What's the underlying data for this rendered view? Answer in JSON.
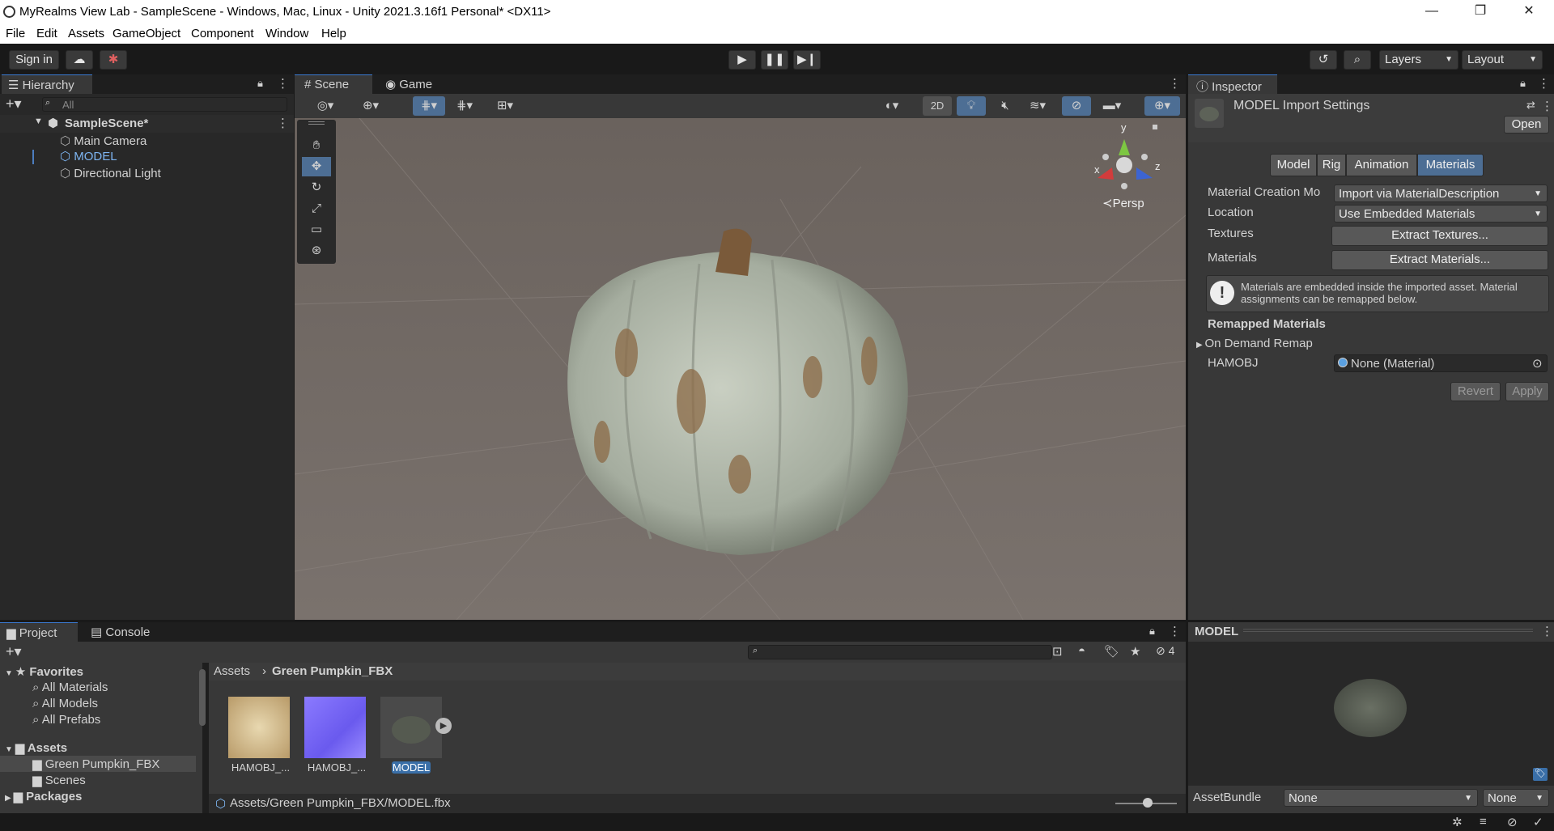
{
  "window": {
    "title": "MyRealms View Lab - SampleScene - Windows, Mac, Linux - Unity 2021.3.16f1 Personal* <DX11>",
    "minimize": "—",
    "restore": "❐",
    "close": "✕"
  },
  "menu": [
    "File",
    "Edit",
    "Assets",
    "GameObject",
    "Component",
    "Window",
    "Help"
  ],
  "toolbar": {
    "sign_in": "Sign in",
    "cloud_icon": "cloud-icon",
    "layers": "Layers",
    "layout": "Layout"
  },
  "hierarchy": {
    "tab": "Hierarchy",
    "search_placeholder": "All",
    "scene": "SampleScene*",
    "items": [
      "Main Camera",
      "MODEL",
      "Directional Light"
    ]
  },
  "scene_view": {
    "tabs": [
      "Scene",
      "Game"
    ],
    "btn_2d": "2D",
    "persp": "Persp",
    "axes": {
      "x": "x",
      "y": "y",
      "z": "z"
    }
  },
  "inspector": {
    "tab": "Inspector",
    "title": "MODEL Import Settings",
    "open": "Open",
    "tabs": [
      "Model",
      "Rig",
      "Animation",
      "Materials"
    ],
    "active_tab": "Materials",
    "material_creation_label": "Material Creation Mo",
    "material_creation_value": "Import via MaterialDescription",
    "location_label": "Location",
    "location_value": "Use Embedded Materials",
    "textures_label": "Textures",
    "extract_textures": "Extract Textures...",
    "materials_label": "Materials",
    "extract_materials": "Extract Materials...",
    "info": "Materials are embedded inside the imported asset. Material assignments can be remapped below.",
    "remapped_header": "Remapped Materials",
    "on_demand": "On Demand Remap",
    "hamobj_label": "HAMOBJ",
    "hamobj_value": "None (Material)",
    "revert": "Revert",
    "apply": "Apply"
  },
  "preview": {
    "title": "MODEL",
    "asset_bundle_label": "AssetBundle",
    "asset_bundle_value": "None",
    "asset_bundle_variant": "None"
  },
  "project": {
    "tabs": [
      "Project",
      "Console"
    ],
    "favorites": "Favorites",
    "fav_items": [
      "All Materials",
      "All Models",
      "All Prefabs"
    ],
    "assets": "Assets",
    "asset_folders": [
      "Green Pumpkin_FBX",
      "Scenes"
    ],
    "packages": "Packages",
    "breadcrumb": [
      "Assets",
      "Green Pumpkin_FBX"
    ],
    "hidden_count": "4",
    "files": [
      "HAMOBJ_...",
      "HAMOBJ_...",
      "MODEL"
    ],
    "path": "Assets/Green Pumpkin_FBX/MODEL.fbx"
  }
}
